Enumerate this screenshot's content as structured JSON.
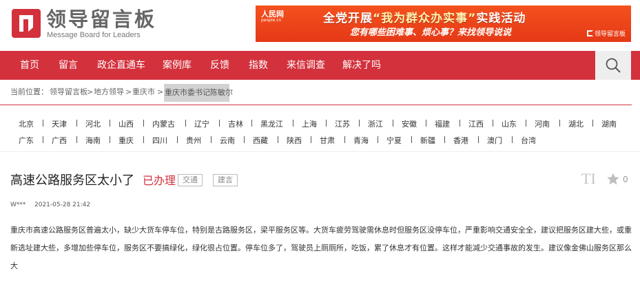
{
  "brand": {
    "title": "领导留言板",
    "subtitle": "Message Board for Leaders"
  },
  "banner": {
    "site_logo": "人民网",
    "site_logo_sub": "people.cn",
    "line1_prefix": "全党开展",
    "line1_highlight": "“我为群众办实事”",
    "line1_suffix": "实践活动",
    "line2": "您有哪些困难事、烦心事？来找领导说说",
    "brand_mark": "领导留言板"
  },
  "nav": {
    "items": [
      "首页",
      "留言",
      "政企直通车",
      "案例库",
      "反馈",
      "指数",
      "来信调查",
      "解决了吗"
    ],
    "search_icon": "search-icon"
  },
  "breadcrumb": {
    "prefix": "当前位置：",
    "items": [
      "领导留言板",
      "地方领导",
      "重庆市"
    ],
    "separator": ">",
    "current": "重庆市委书记陈敏尔"
  },
  "provinces": {
    "row1": [
      "北京",
      "天津",
      "河北",
      "山西",
      "内蒙古",
      "辽宁",
      "吉林",
      "黑龙江",
      "上海",
      "江苏",
      "浙江",
      "安徽",
      "福建",
      "江西",
      "山东",
      "河南",
      "湖北",
      "湖南"
    ],
    "row2": [
      "广东",
      "广西",
      "海南",
      "重庆",
      "四川",
      "贵州",
      "云南",
      "西藏",
      "陕西",
      "甘肃",
      "青海",
      "宁夏",
      "新疆",
      "香港",
      "澳门",
      "台湾"
    ]
  },
  "message": {
    "title": "高速公路服务区太小了",
    "status": "已办理",
    "tags": [
      "交通",
      "建言"
    ],
    "font_icon": "TI",
    "favorite_count": "0",
    "author": "W***",
    "time": "2021-05-28 21:42",
    "content": "重庆市高速公路服务区普遍太小，缺少大货车停车位，特别是古路服务区，梁平服务区等。大货车疲劳驾驶需休息时但服务区没停车位，严重影响交通安全全，建议把服务区建大些，或重新选址建大些，多增加些停车位，服务区不要搞绿化，绿化很占位置。停车位多了，驾驶员上厕厕所，吃饭，累了休息才有位置。这样才能减少交通事故的发生。建议像金佛山服务区那么大"
  },
  "colors": {
    "nav_bg": "#d3313c",
    "status_red": "#d3313c",
    "banner_orange": "#e8471c"
  }
}
